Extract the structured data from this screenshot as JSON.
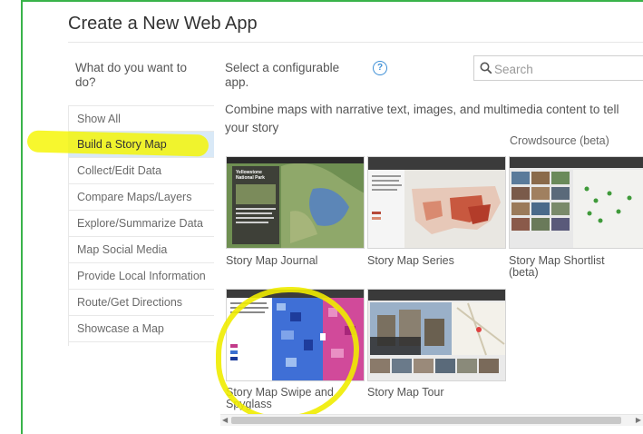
{
  "dialog": {
    "title": "Create a New Web App",
    "question": "What do you want to do?",
    "select_label": "Select a configurable app.",
    "help": "?",
    "search": {
      "placeholder": "Search"
    },
    "description": "Combine maps with narrative text, images, and multimedia content to tell your story"
  },
  "sidebar": {
    "items": [
      {
        "label": "Show All"
      },
      {
        "label": "Build a Story Map"
      },
      {
        "label": "Collect/Edit Data"
      },
      {
        "label": "Compare Maps/Layers"
      },
      {
        "label": "Explore/Summarize Data"
      },
      {
        "label": "Map Social Media"
      },
      {
        "label": "Provide Local Information"
      },
      {
        "label": "Route/Get Directions"
      },
      {
        "label": "Showcase a Map"
      }
    ],
    "active_index": 1
  },
  "apps": {
    "partial_label": "Crowdsource (beta)",
    "cards": [
      {
        "label": "Story Map Journal",
        "thumb_text": "Yellowstone National Park"
      },
      {
        "label": "Story Map Series"
      },
      {
        "label": "Story Map Shortlist (beta)"
      },
      {
        "label": "Story Map Swipe and Spyglass"
      },
      {
        "label": "Story Map Tour"
      }
    ]
  },
  "colors": {
    "highlight": "#f5f500",
    "active_bg": "#d9e9f7",
    "help_blue": "#3d8fd6",
    "frame_green": "#39b34a"
  }
}
